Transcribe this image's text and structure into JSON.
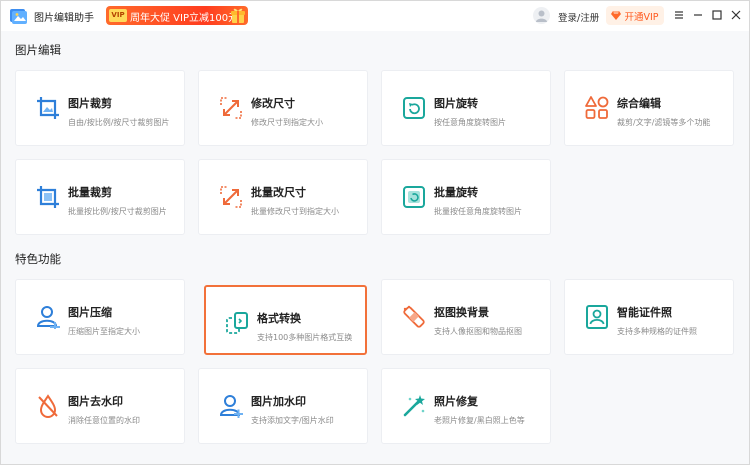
{
  "titlebar": {
    "app_title": "图片编辑助手",
    "promo_tag": "VIP",
    "promo_text": "周年大促 VIP立减100元",
    "login_text": "登录/注册",
    "vip_button": "开通VIP"
  },
  "colors": {
    "accent_orange": "#f2713a",
    "icon_blue": "#2e7fd9",
    "icon_teal": "#1aa79c",
    "icon_orange": "#ef6a3a"
  },
  "sections": [
    {
      "title": "图片编辑",
      "cards": [
        {
          "title": "图片裁剪",
          "desc": "自由/按比例/按尺寸裁剪图片",
          "icon": "crop-icon"
        },
        {
          "title": "修改尺寸",
          "desc": "修改尺寸到指定大小",
          "icon": "resize-icon"
        },
        {
          "title": "图片旋转",
          "desc": "按任意角度旋转图片",
          "icon": "rotate-icon"
        },
        {
          "title": "综合编辑",
          "desc": "裁剪/文字/滤镜等多个功能",
          "icon": "shapes-icon"
        },
        {
          "title": "批量裁剪",
          "desc": "批量按比例/按尺寸裁剪图片",
          "icon": "batch-crop-icon"
        },
        {
          "title": "批量改尺寸",
          "desc": "批量修改尺寸到指定大小",
          "icon": "batch-resize-icon"
        },
        {
          "title": "批量旋转",
          "desc": "批量按任意角度旋转图片",
          "icon": "batch-rotate-icon"
        }
      ]
    },
    {
      "title": "特色功能",
      "cards": [
        {
          "title": "图片压缩",
          "desc": "压缩图片至指定大小",
          "icon": "compress-icon"
        },
        {
          "title": "格式转换",
          "desc": "支持100多种图片格式互换",
          "icon": "convert-icon"
        },
        {
          "title": "抠图换背景",
          "desc": "支持人像抠图和物品抠图",
          "icon": "cutout-icon"
        },
        {
          "title": "智能证件照",
          "desc": "支持多种规格的证件照",
          "icon": "id-photo-icon"
        },
        {
          "title": "图片去水印",
          "desc": "消除任意位置的水印",
          "icon": "remove-watermark-icon"
        },
        {
          "title": "图片加水印",
          "desc": "支持添加文字/图片水印",
          "icon": "add-watermark-icon"
        },
        {
          "title": "照片修复",
          "desc": "老照片修复/黑白照上色等",
          "icon": "magic-wand-icon"
        }
      ]
    }
  ]
}
